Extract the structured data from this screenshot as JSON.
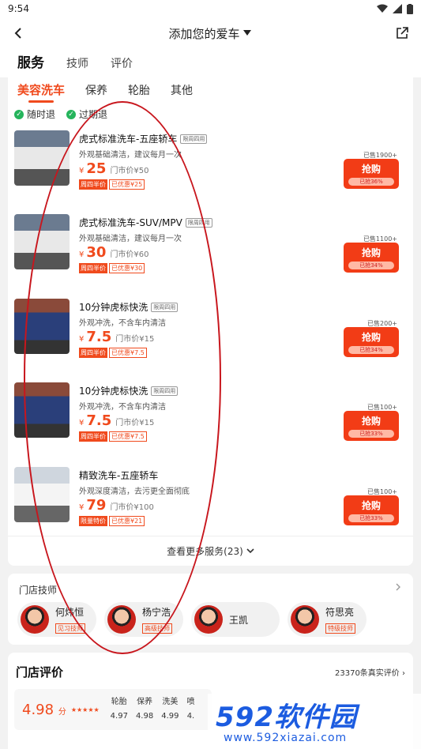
{
  "status": {
    "time": "9:54"
  },
  "header": {
    "title": "添加您的爱车"
  },
  "tabs": [
    "服务",
    "技师",
    "评价"
  ],
  "subtabs": [
    "美容洗车",
    "保养",
    "轮胎",
    "其他"
  ],
  "guarantees": [
    "随时退",
    "过期退"
  ],
  "items": [
    {
      "name": "虎式标准洗车-五座轿车",
      "tag": "限周四用",
      "desc": "外观基础清洁，建议每月一次",
      "yen": "¥",
      "price": "25",
      "market": "门市价¥50",
      "promo1": "周四半价",
      "promo2": "已优惠¥25",
      "sold": "已售1900+",
      "buy": "抢购",
      "progress": "已抢36%"
    },
    {
      "name": "虎式标准洗车-SUV/MPV",
      "tag": "限周四用",
      "desc": "外观基础清洁，建议每月一次",
      "yen": "¥",
      "price": "30",
      "market": "门市价¥60",
      "promo1": "周四半价",
      "promo2": "已优惠¥30",
      "sold": "已售1100+",
      "buy": "抢购",
      "progress": "已抢34%"
    },
    {
      "name": "10分钟虎标快洗",
      "tag": "限周四用",
      "desc": "外观冲洗，不含车内清洁",
      "yen": "¥",
      "price": "7.5",
      "market": "门市价¥15",
      "promo1": "周四半价",
      "promo2": "已优惠¥7.5",
      "sold": "已售200+",
      "buy": "抢购",
      "progress": "已抢34%"
    },
    {
      "name": "10分钟虎标快洗",
      "tag": "限周四用",
      "desc": "外观冲洗，不含车内清洁",
      "yen": "¥",
      "price": "7.5",
      "market": "门市价¥15",
      "promo1": "周四半价",
      "promo2": "已优惠¥7.5",
      "sold": "已售100+",
      "buy": "抢购",
      "progress": "已抢33%"
    },
    {
      "name": "精致洗车-五座轿车",
      "tag": "",
      "desc": "外观深度清洁，去污更全面彻底",
      "yen": "¥",
      "price": "79",
      "market": "门市价¥100",
      "promo1": "限量特价",
      "promo2": "已优惠¥21",
      "sold": "已售100+",
      "buy": "抢购",
      "progress": "已抢33%"
    }
  ],
  "more": "查看更多服务(23)",
  "techs": {
    "title": "门店技师",
    "list": [
      {
        "name": "何炜恒",
        "level": "见习技师"
      },
      {
        "name": "杨宁浩",
        "level": "高级技师"
      },
      {
        "name": "王凯",
        "level": ""
      },
      {
        "name": "符思亮",
        "level": "特级技师"
      }
    ]
  },
  "reviews": {
    "title": "门店评价",
    "count": "23370条真实评价",
    "score": "4.98",
    "unit": "分",
    "stars": "★★★★★",
    "cats": [
      {
        "label": "轮胎",
        "val": "4.97"
      },
      {
        "label": "保养",
        "val": "4.98"
      },
      {
        "label": "洗美",
        "val": "4.99"
      },
      {
        "label": "喷",
        "val": "4."
      }
    ]
  },
  "watermark": {
    "brand": "592软件园",
    "url": "www.592xiazai.com"
  }
}
